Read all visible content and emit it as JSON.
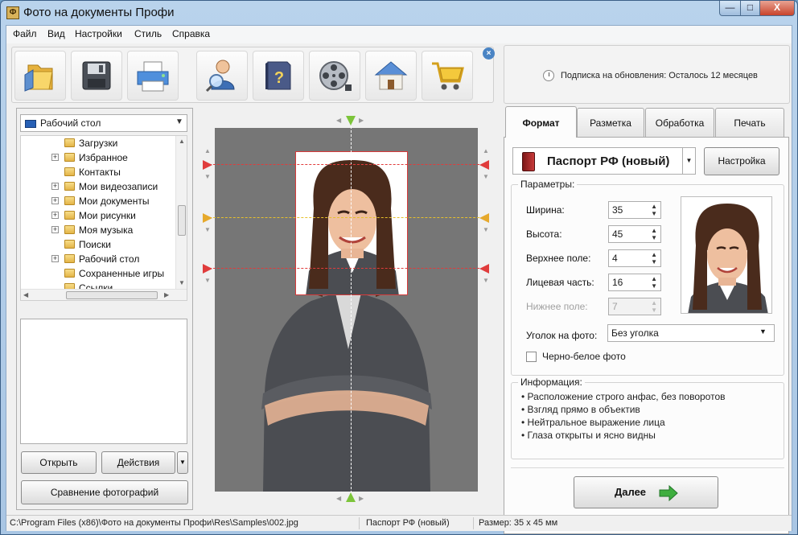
{
  "window": {
    "title": "Фото на документы Профи",
    "app_icon_letter": "Ф",
    "minimize": "—",
    "maximize": "□",
    "close": "X"
  },
  "menu": [
    "Файл",
    "Вид",
    "Настройки",
    "Стиль",
    "Справка"
  ],
  "toolbar": {
    "tools": [
      "folder-open-icon",
      "save-icon",
      "printer-icon",
      "user-search-icon",
      "help-book-icon",
      "film-reel-icon",
      "home-icon",
      "shopping-cart-icon"
    ],
    "close_glyph": "×"
  },
  "subscription": {
    "text": "Подписка на обновления: Осталось 12 месяцев"
  },
  "browser": {
    "location": "Рабочий стол",
    "tree": [
      {
        "label": "Загрузки",
        "expandable": false
      },
      {
        "label": "Избранное",
        "expandable": true
      },
      {
        "label": "Контакты",
        "expandable": false
      },
      {
        "label": "Мои видеозаписи",
        "expandable": true
      },
      {
        "label": "Мои документы",
        "expandable": true
      },
      {
        "label": "Мои рисунки",
        "expandable": true
      },
      {
        "label": "Моя музыка",
        "expandable": true
      },
      {
        "label": "Поиски",
        "expandable": false
      },
      {
        "label": "Рабочий стол",
        "expandable": true
      },
      {
        "label": "Сохраненные игры",
        "expandable": false
      },
      {
        "label": "Ссылки",
        "expandable": false
      }
    ],
    "open_label": "Открыть",
    "actions_label": "Действия",
    "compare_label": "Сравнение фотографий"
  },
  "tabs": [
    {
      "label": "Формат",
      "active": true
    },
    {
      "label": "Разметка",
      "active": false
    },
    {
      "label": "Обработка",
      "active": false
    },
    {
      "label": "Печать",
      "active": false
    }
  ],
  "format": {
    "document": "Паспорт РФ (новый)",
    "settings_label": "Настройка",
    "params_title": "Параметры:",
    "params": [
      {
        "label": "Ширина:",
        "value": "35",
        "enabled": true
      },
      {
        "label": "Высота:",
        "value": "45",
        "enabled": true
      },
      {
        "label": "Верхнее поле:",
        "value": "4",
        "enabled": true
      },
      {
        "label": "Лицевая часть:",
        "value": "16",
        "enabled": true
      },
      {
        "label": "Нижнее поле:",
        "value": "7",
        "enabled": false
      }
    ],
    "corner_label": "Уголок на фото:",
    "corner_value": "Без уголка",
    "bw_label": "Черно-белое фото",
    "bw_checked": false,
    "info_title": "Информация:",
    "info": [
      "Расположение строго анфас, без поворотов",
      "Взгляд прямо в объектив",
      "Нейтральное выражение лица",
      "Глаза открыты и ясно видны"
    ],
    "next_label": "Далее"
  },
  "status": {
    "path": "C:\\Program Files (x86)\\Фото на документы Профи\\Res\\Samples\\002.jpg",
    "format": "Паспорт РФ (новый)",
    "size": "Размер: 35 x 45 мм"
  },
  "colors": {
    "guide_red": "#e03c3c",
    "guide_yellow": "#e6c02c",
    "marker_green": "#7cc43a",
    "accent_arrow": "#3fae3f"
  }
}
